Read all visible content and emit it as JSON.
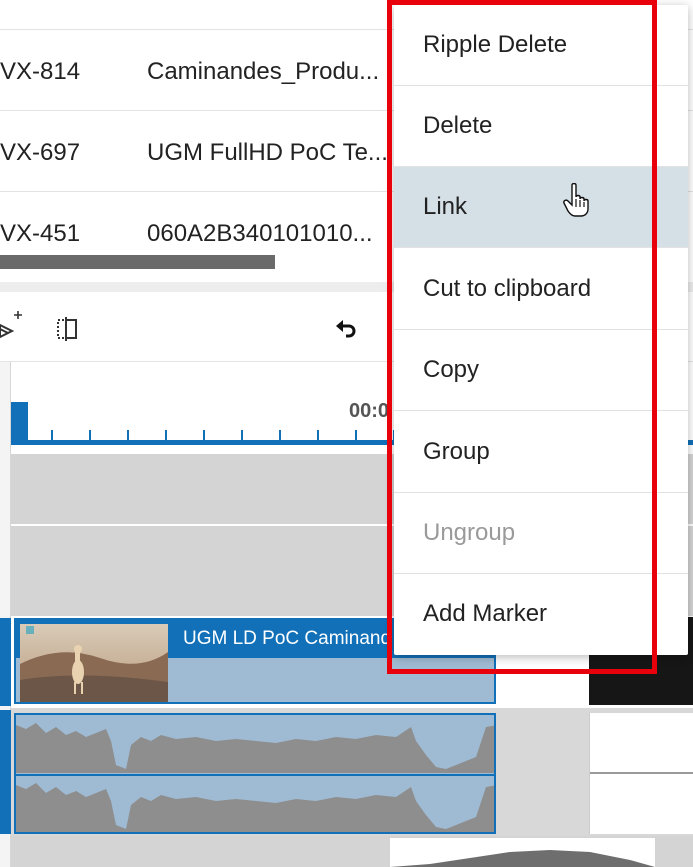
{
  "table": {
    "rows": [
      {
        "id": "",
        "title": ""
      },
      {
        "id": "VX-814",
        "title": "Caminandes_Produ..."
      },
      {
        "id": "VX-697",
        "title": "UGM FullHD PoC Te..."
      },
      {
        "id": "VX-451",
        "title": "060A2B340101010..."
      }
    ]
  },
  "toolbar": {
    "icons": [
      "add-track-icon",
      "split-icon",
      "undo-icon"
    ]
  },
  "ruler": {
    "timecode": "00:0"
  },
  "timeline": {
    "video_clip_title": "UGM LD PoC Caminand",
    "accent_color": "#1170b8"
  },
  "context_menu": {
    "items": [
      {
        "label": "Ripple Delete",
        "enabled": true
      },
      {
        "label": "Delete",
        "enabled": true
      },
      {
        "label": "Link",
        "enabled": true,
        "hovered": true
      },
      {
        "label": "Cut to clipboard",
        "enabled": true
      },
      {
        "label": "Copy",
        "enabled": true
      },
      {
        "label": "Group",
        "enabled": true
      },
      {
        "label": "Ungroup",
        "enabled": false
      },
      {
        "label": "Add Marker",
        "enabled": true
      }
    ],
    "highlight_color": "#e8000a"
  }
}
